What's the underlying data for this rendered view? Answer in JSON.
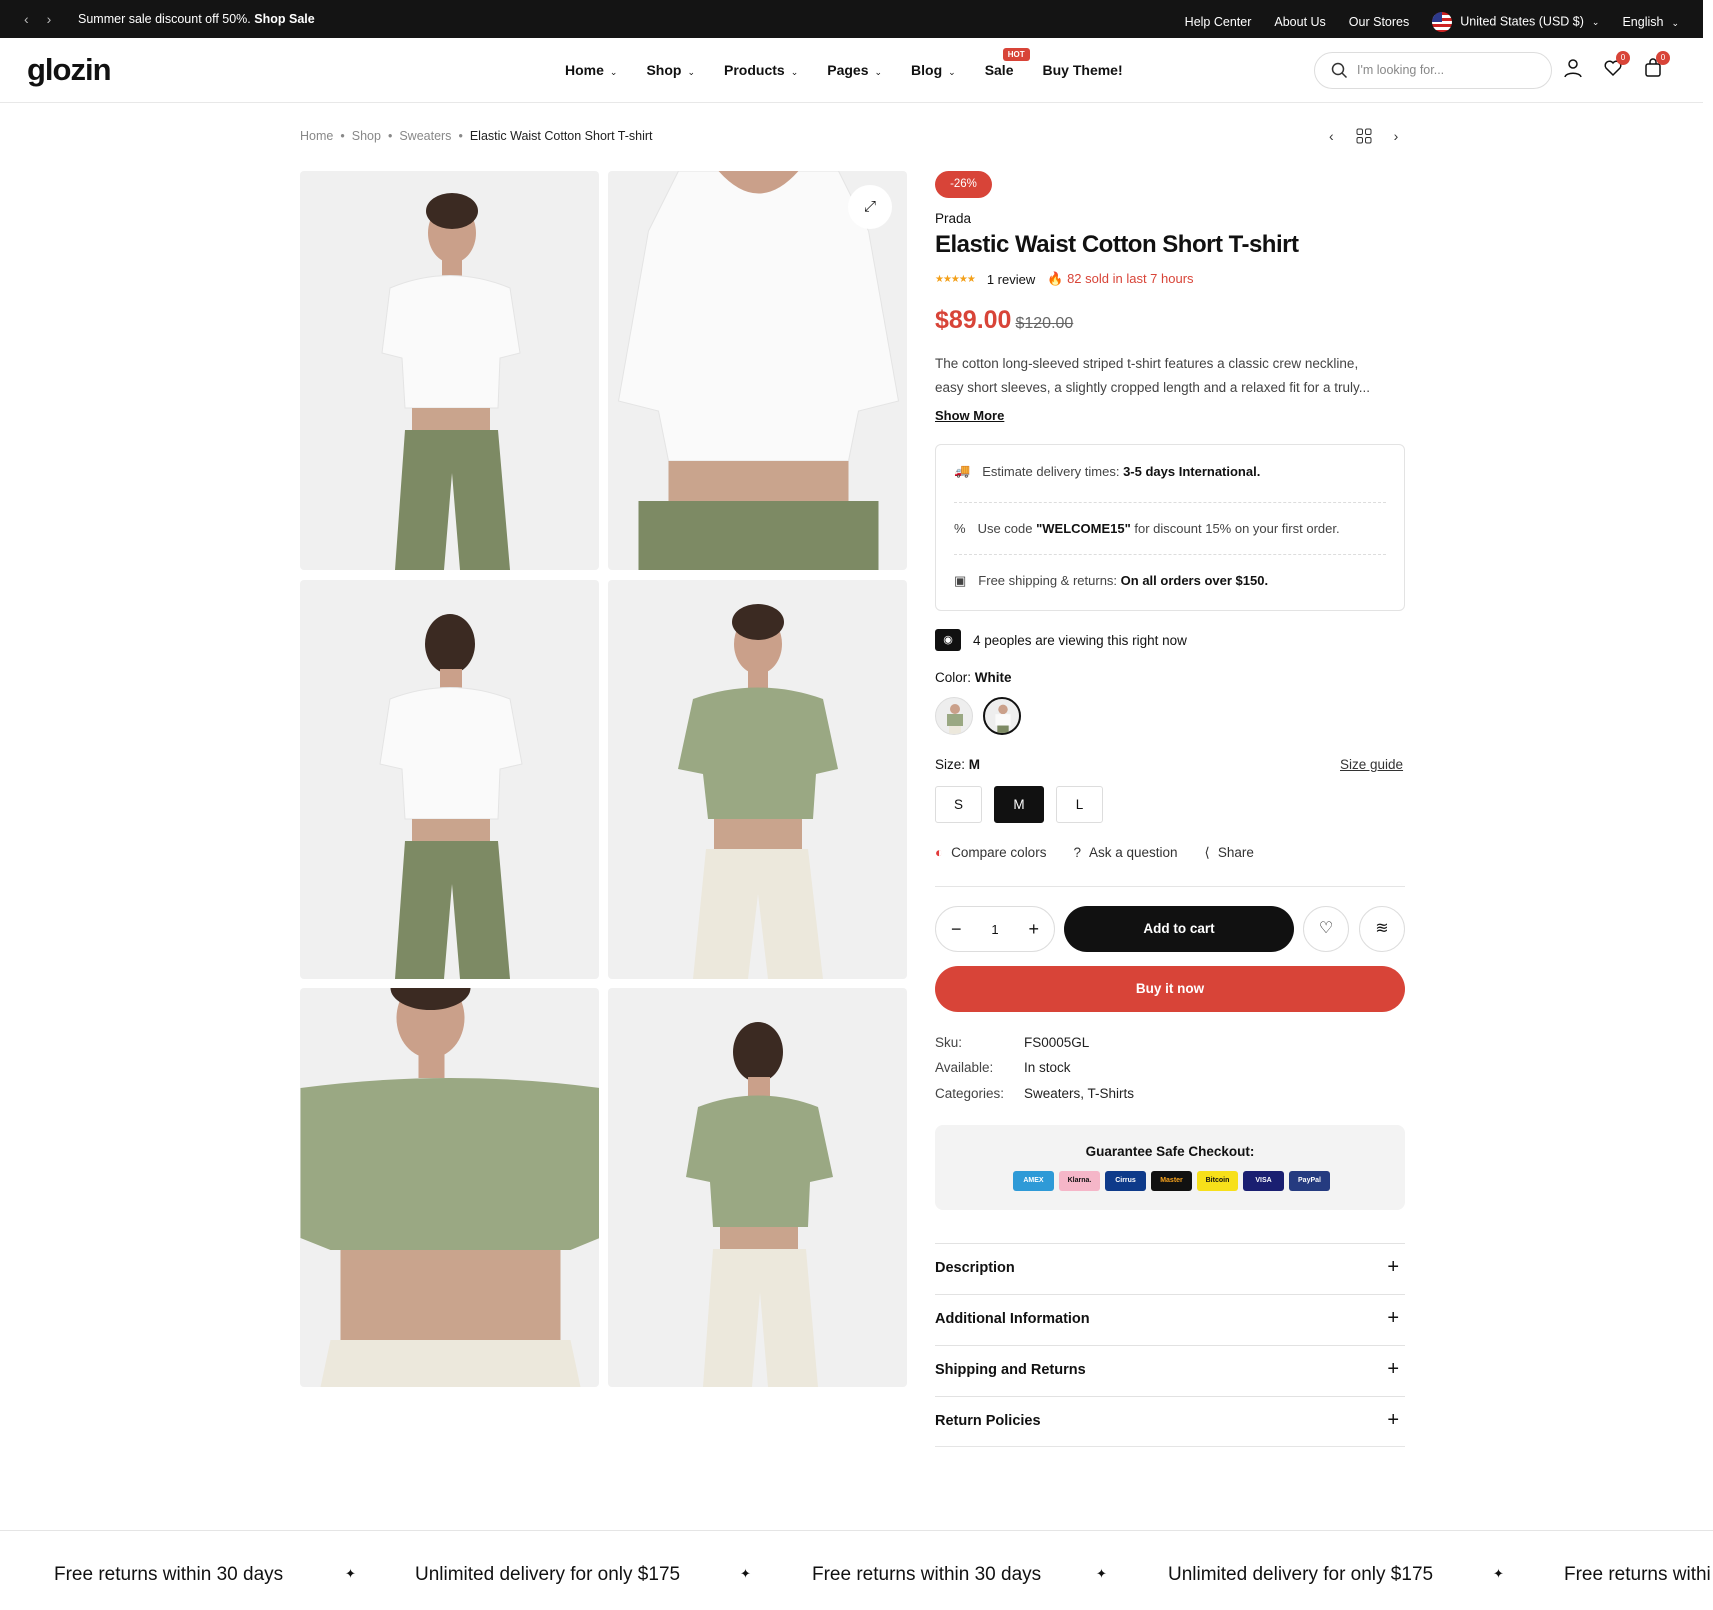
{
  "topbar": {
    "promo_text": "Summer sale discount off 50%.",
    "promo_link": "Shop Sale",
    "links": [
      "Help Center",
      "About Us",
      "Our Stores"
    ],
    "currency": "United States (USD $)",
    "language": "English"
  },
  "header": {
    "logo": "glozin",
    "nav": [
      "Home",
      "Shop",
      "Products",
      "Pages",
      "Blog",
      "Sale",
      "Buy Theme!"
    ],
    "hot_badge": "HOT",
    "search_placeholder": "I'm looking for...",
    "wishlist_count": "0",
    "cart_count": "0"
  },
  "breadcrumb": [
    "Home",
    "Shop",
    "Sweaters",
    "Elastic Waist Cotton Short T-shirt"
  ],
  "product": {
    "discount": "-26%",
    "brand": "Prada",
    "title": "Elastic Waist Cotton Short T-shirt",
    "review_text": "1 review",
    "rating": 5,
    "sold_text": "82 sold in last 7 hours",
    "price": "$89.00",
    "old_price": "$120.00",
    "desc_line1": "The cotton long-sleeved striped t-shirt features a classic crew neckline,",
    "desc_line2": "easy short sleeves, a slightly cropped length and a relaxed fit for a truly...",
    "show_more": "Show More",
    "info": [
      {
        "a": "Estimate delivery times: ",
        "b": "3-5 days International."
      },
      {
        "a": "Use code ",
        "b": "\"WELCOME15\"",
        "c": " for discount 15% on your first order."
      },
      {
        "a": "Free shipping & returns: ",
        "b": "On all orders over $150."
      }
    ],
    "viewing": "4 peoples are viewing this right now",
    "color_label": "Color:",
    "color_value": "White",
    "size_label": "Size:",
    "size_value": "M",
    "size_guide": "Size guide",
    "sizes": [
      "S",
      "M",
      "L"
    ],
    "actions": [
      "Compare colors",
      "Ask a question",
      "Share"
    ],
    "qty": "1",
    "add_to_cart": "Add to cart",
    "buy_now": "Buy it now",
    "meta": [
      {
        "k": "Sku:",
        "v": "FS0005GL"
      },
      {
        "k": "Available:",
        "v": "In stock"
      },
      {
        "k": "Categories:",
        "v": "Sweaters, T-Shirts"
      }
    ],
    "guarantee": "Guarantee Safe Checkout:",
    "payments": [
      "AMEX",
      "Klarna.",
      "Cirrus",
      "Master",
      "Bitcoin",
      "VISA",
      "PayPal"
    ],
    "accordion": [
      "Description",
      "Additional Information",
      "Shipping and Returns",
      "Return Policies"
    ]
  },
  "marquee": [
    "Free returns within 30 days",
    "Unlimited delivery for only $175",
    "Free returns within 30 days",
    "Unlimited delivery for only $175",
    "Free returns withi"
  ],
  "colors": {
    "accent": "#d84438",
    "dark": "#111111"
  }
}
